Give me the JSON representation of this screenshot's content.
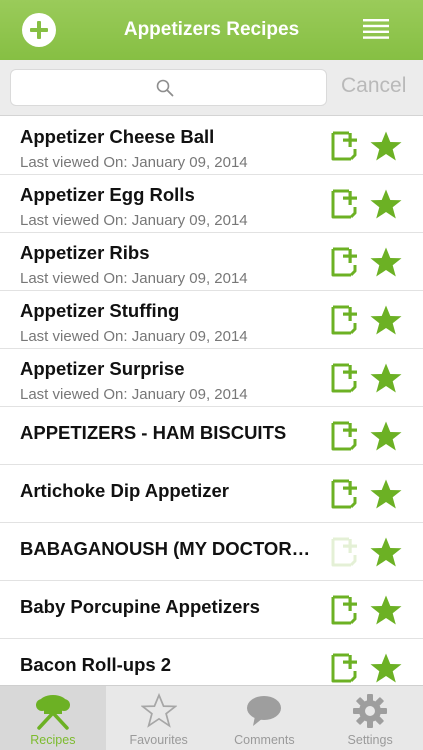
{
  "header": {
    "title": "Appetizers Recipes",
    "add_icon": "plus-circle-icon",
    "menu_icon": "list-menu-icon"
  },
  "search": {
    "value": "",
    "placeholder": "",
    "icon": "magnifier-icon",
    "cancel_label": "Cancel"
  },
  "recipes": [
    {
      "title": "Appetizer Cheese Ball",
      "subtitle": "Last viewed On: January 09, 2014",
      "note_enabled": true
    },
    {
      "title": "Appetizer Egg Rolls",
      "subtitle": "Last viewed On: January 09, 2014",
      "note_enabled": true
    },
    {
      "title": "Appetizer Ribs",
      "subtitle": "Last viewed On: January 09, 2014",
      "note_enabled": true
    },
    {
      "title": "Appetizer Stuffing",
      "subtitle": "Last viewed On: January 09, 2014",
      "note_enabled": true
    },
    {
      "title": "Appetizer Surprise",
      "subtitle": "Last viewed On: January 09, 2014",
      "note_enabled": true
    },
    {
      "title": "APPETIZERS - HAM BISCUITS",
      "subtitle": "",
      "note_enabled": true
    },
    {
      "title": "Artichoke Dip Appetizer",
      "subtitle": "",
      "note_enabled": true
    },
    {
      "title": "BABAGANOUSH (MY DOCTOR…",
      "subtitle": "",
      "note_enabled": false
    },
    {
      "title": "Baby Porcupine Appetizers",
      "subtitle": "",
      "note_enabled": true
    },
    {
      "title": "Bacon Roll-ups 2",
      "subtitle": "",
      "note_enabled": true
    }
  ],
  "tabs": [
    {
      "label": "Recipes",
      "icon": "chef-utensils-icon",
      "active": true
    },
    {
      "label": "Favourites",
      "icon": "star-outline-icon",
      "active": false
    },
    {
      "label": "Comments",
      "icon": "speech-bubble-icon",
      "active": false
    },
    {
      "label": "Settings",
      "icon": "gear-icon",
      "active": false
    }
  ],
  "colors": {
    "accent": "#86bf43",
    "icon_green": "#6cb124",
    "active_tab_label": "#7cbb2e"
  }
}
